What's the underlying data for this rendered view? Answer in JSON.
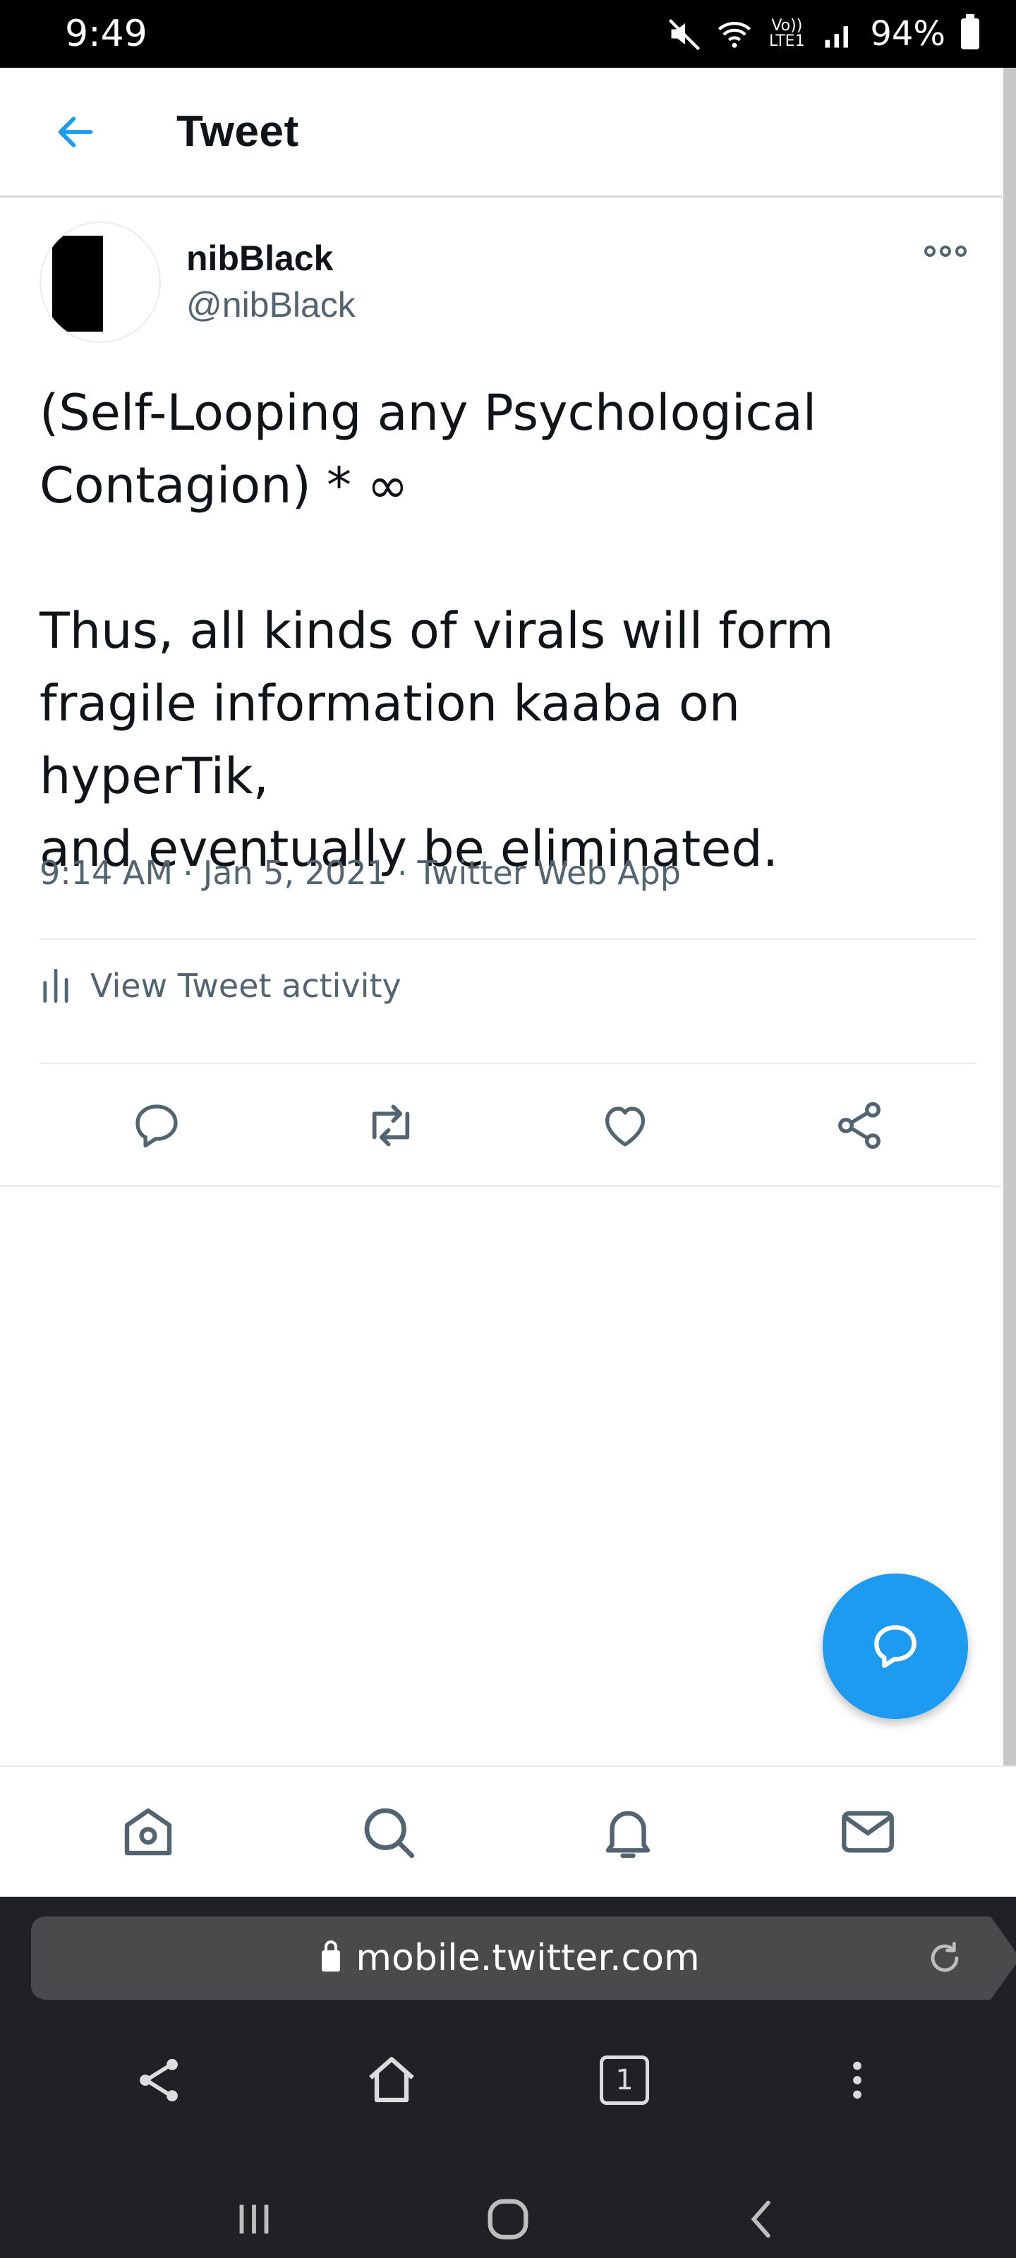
{
  "status_bar": {
    "time": "9:49",
    "signal_label": "Vo)) LTE1",
    "battery": "94%"
  },
  "header": {
    "title": "Tweet",
    "back_icon": "arrow-left-icon"
  },
  "tweet": {
    "display_name": "nibBlack",
    "handle": "@nibBlack",
    "text_lines": [
      "(Self-Looping any Psychological",
      "Contagion) * ∞",
      "Thus, all kinds of virals will form",
      "fragile information kaaba on hyperTik,",
      "and eventually be eliminated."
    ],
    "time": "9:14 AM",
    "separator": "·",
    "date": "Jan 5, 2021",
    "source": "Twitter Web App",
    "activity_label": "View Tweet activity",
    "actions": [
      "reply-icon",
      "retweet-icon",
      "like-icon",
      "share-icon"
    ]
  },
  "colors": {
    "accent": "#1d9bf0",
    "secondary_text": "#536471",
    "primary_text": "#0f1419",
    "divider": "#e6ecf0",
    "browser_bg": "#202124"
  },
  "bottom_nav": [
    "home-icon",
    "search-icon",
    "notifications-icon",
    "messages-icon"
  ],
  "browser": {
    "url": "mobile.twitter.com",
    "tab_count": "1"
  }
}
